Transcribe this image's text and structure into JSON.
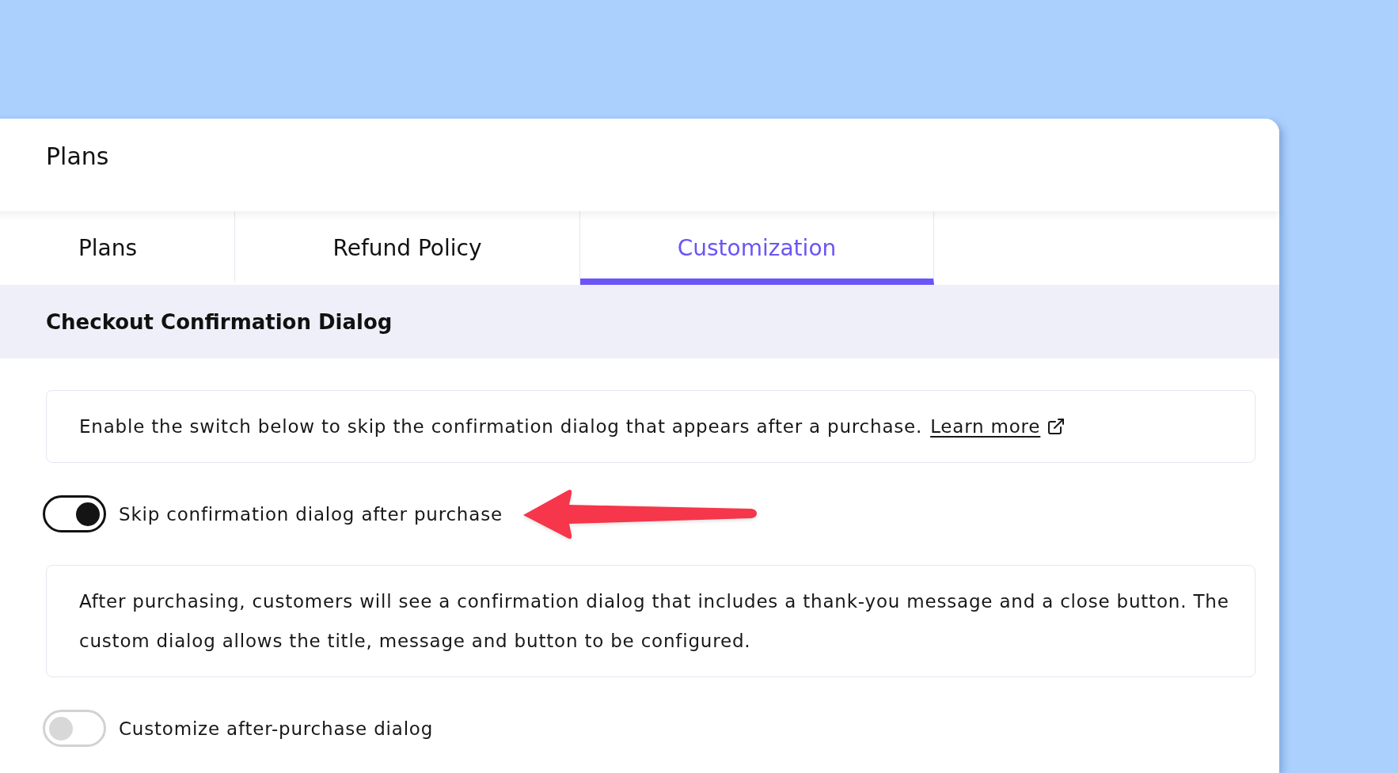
{
  "header": {
    "title": "Plans"
  },
  "tabs": [
    {
      "label": "Plans",
      "selected": false
    },
    {
      "label": "Refund Policy",
      "selected": false
    },
    {
      "label": "Customization",
      "selected": true
    }
  ],
  "section": {
    "title": "Checkout Confirmation Dialog",
    "items": [
      {
        "kind": "note",
        "text": "Enable the switch below to skip the confirmation dialog that appears after a purchase.",
        "link": "Learn more"
      },
      {
        "kind": "toggle",
        "label": "Skip confirmation dialog after purchase",
        "on": true,
        "annotated": true
      },
      {
        "kind": "note",
        "text": "After purchasing, customers will see a confirmation dialog that includes a thank-you message and a close button. The custom dialog allows the title, message and button to be configured."
      },
      {
        "kind": "toggle",
        "label": "Customize after-purchase dialog",
        "on": false
      }
    ]
  }
}
